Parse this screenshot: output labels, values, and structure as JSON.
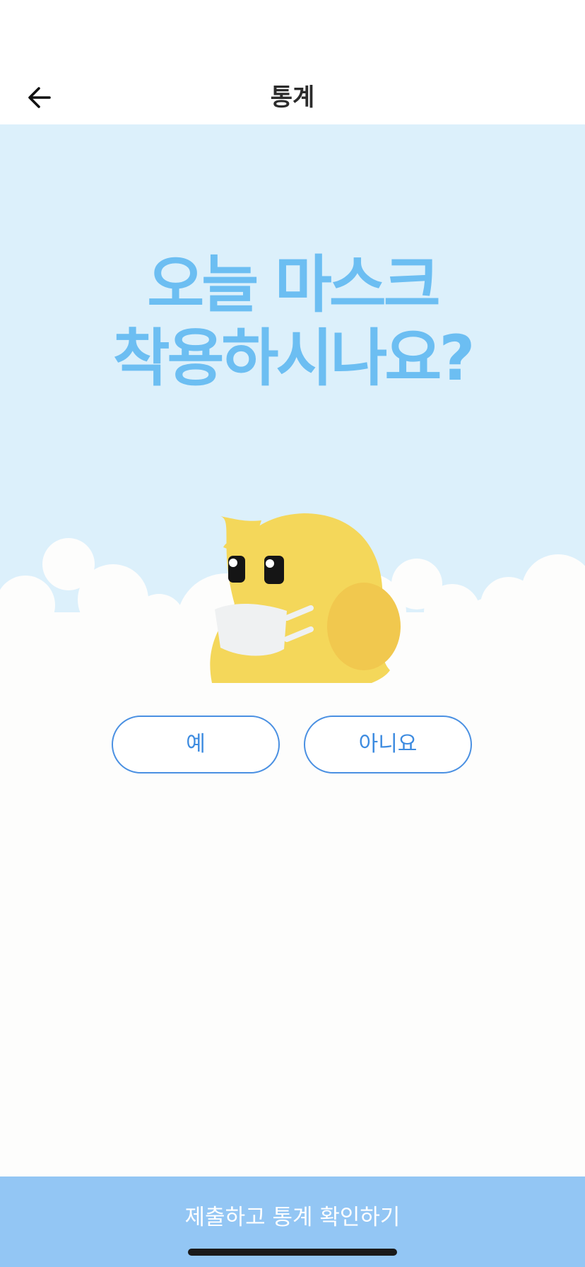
{
  "nav": {
    "title": "통계",
    "back_icon": "arrow-left-icon"
  },
  "question": {
    "line1": "오늘 마스크",
    "line2": "착용하시나요?"
  },
  "answers": {
    "yes_label": "예",
    "no_label": "아니요"
  },
  "submit": {
    "label": "제출하고 통계 확인하기"
  },
  "illustration": {
    "name": "masked-yellow-bird-mascot-illustration"
  },
  "colors": {
    "sky": "#dcf0fb",
    "headline": "#6cbef2",
    "accent": "#4a90e2",
    "submit_bg": "#93c6f4",
    "mascot_body": "#f4d75a"
  }
}
